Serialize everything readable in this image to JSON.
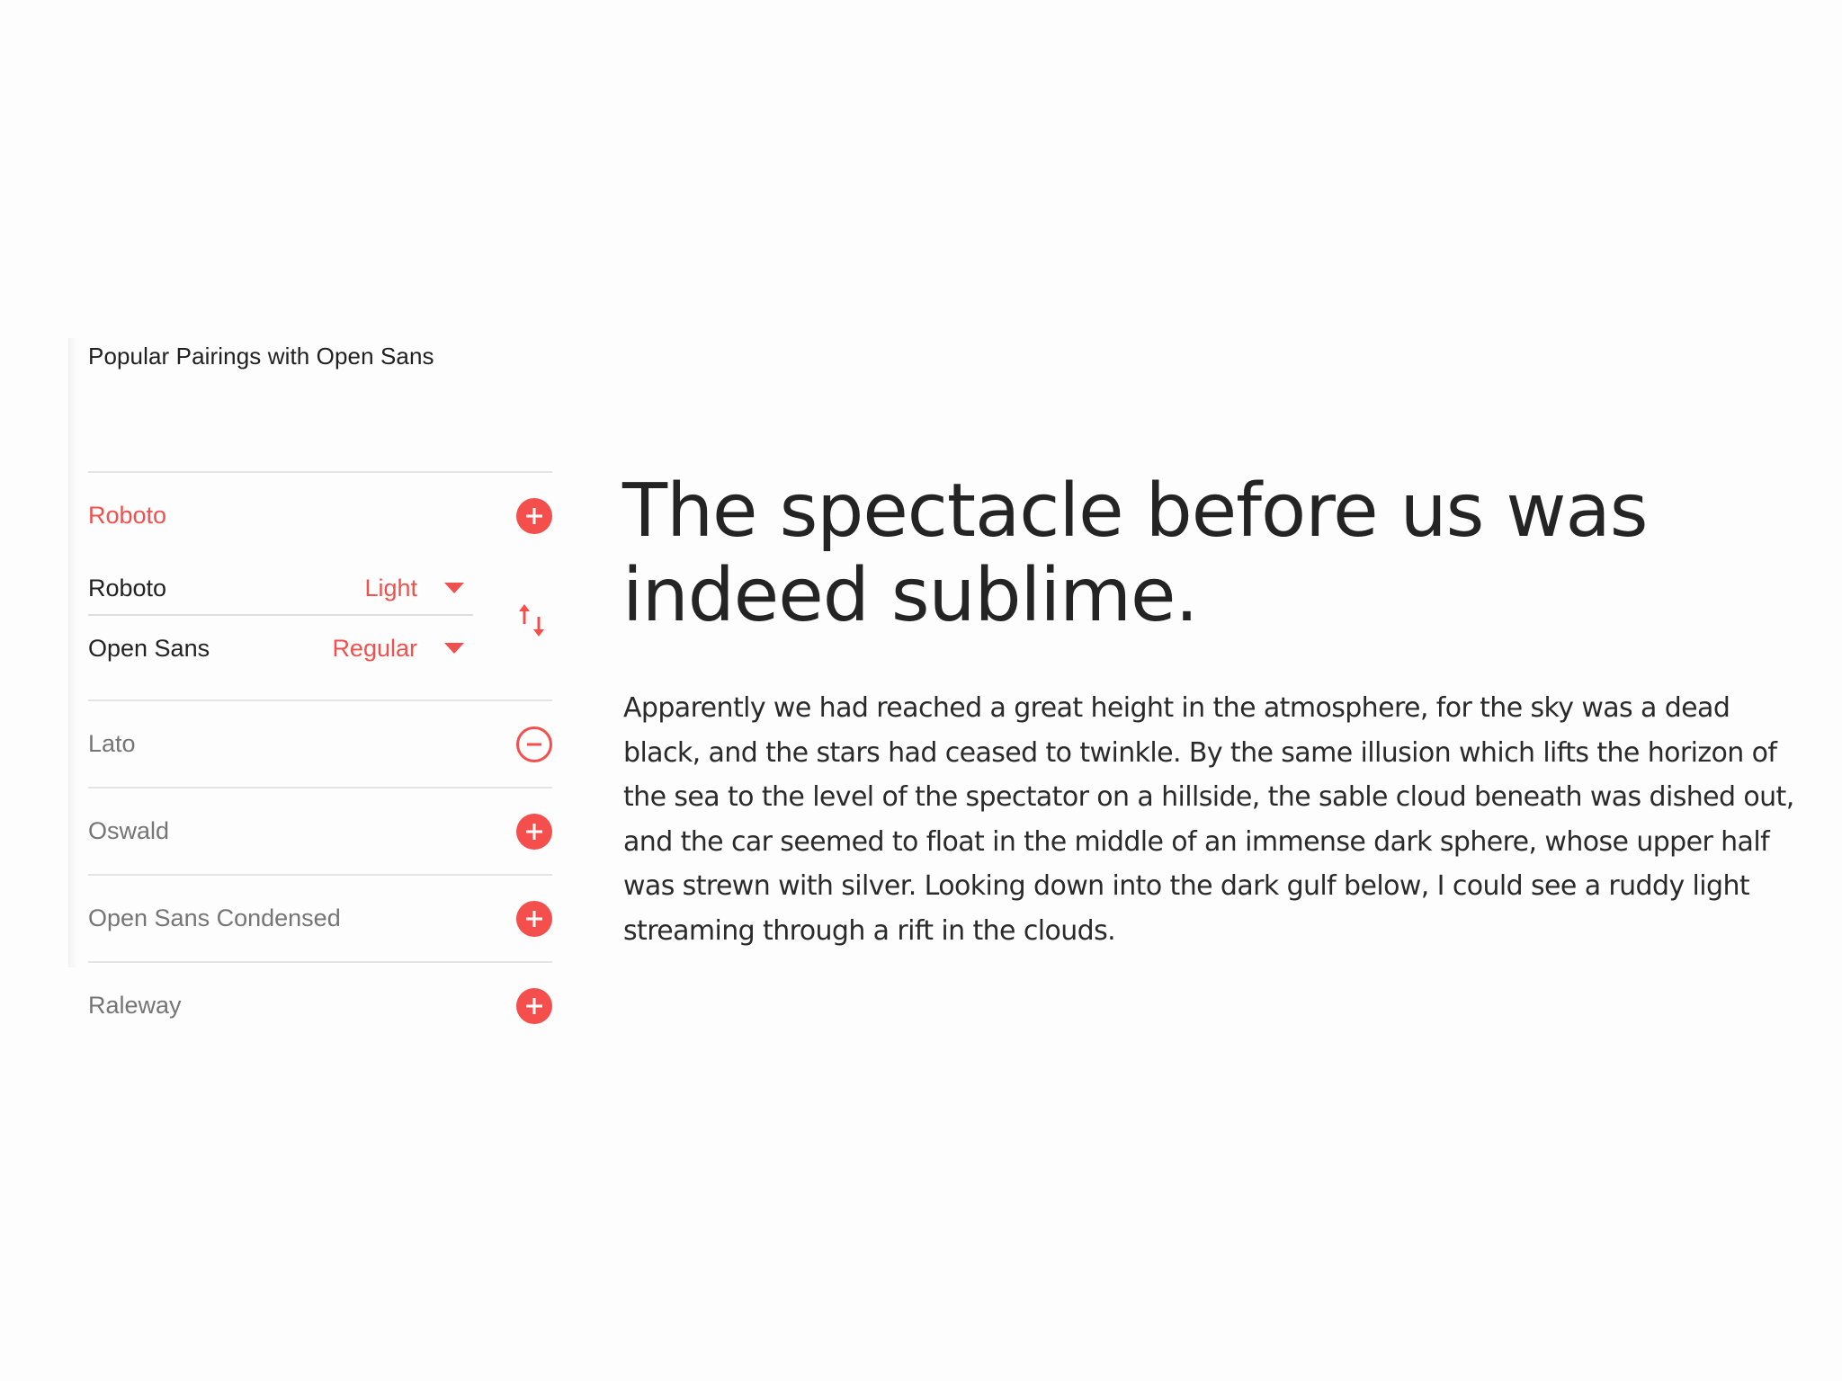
{
  "section": {
    "title": "Popular Pairings with Open Sans"
  },
  "pairings": {
    "active_font": "Roboto",
    "selected": {
      "primary_font": "Roboto",
      "primary_weight": "Light",
      "secondary_font": "Open Sans",
      "secondary_weight": "Regular"
    },
    "others": [
      {
        "name": "Lato",
        "action": "remove"
      },
      {
        "name": "Oswald",
        "action": "add"
      },
      {
        "name": "Open Sans Condensed",
        "action": "add"
      },
      {
        "name": "Raleway",
        "action": "add"
      }
    ]
  },
  "preview": {
    "headline": "The spectacle before us was indeed sublime.",
    "body": "Apparently we had reached a great height in the atmosphere, for the sky was a dead black, and the stars had ceased to twinkle. By the same illusion which lifts the horizon of the sea to the level of the spectator on a hillside, the sable cloud beneath was dished out, and the car seemed to float in the middle of an immense dark sphere, whose upper half was strewn with silver. Looking down into the dark gulf below, I could see a ruddy light streaming through a rift in the clouds."
  },
  "icons": {
    "add": "plus-circle-icon",
    "remove": "minus-circle-icon",
    "swap": "swap-vertical-icon",
    "dropdown": "caret-down-icon"
  },
  "colors": {
    "accent": "#f44f4d",
    "text_dark": "#212121",
    "text_muted": "#757575",
    "divider": "#e4e4e4"
  }
}
